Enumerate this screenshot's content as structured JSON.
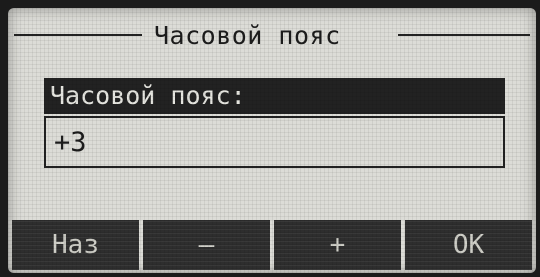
{
  "screen": {
    "title": "Часовой пояс",
    "field_label": "Часовой пояс:",
    "field_value": "+3"
  },
  "softkeys": [
    {
      "label": "Наз"
    },
    {
      "label": "—"
    },
    {
      "label": "+"
    },
    {
      "label": "OK"
    }
  ],
  "colors": {
    "lcd_background": "#dcdcd7",
    "pixel_dark": "#222222",
    "softkey_background": "#2e2e2e"
  }
}
